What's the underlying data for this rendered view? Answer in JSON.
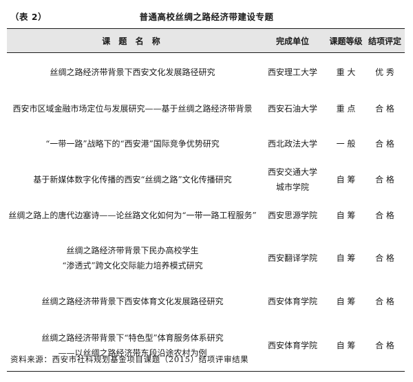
{
  "header": {
    "table_number": "（表 2）",
    "title": "普通高校丝绸之路经济带建设专题"
  },
  "columns": [
    "课 题 名 称",
    "完成单位",
    "课题等级",
    "结项评定"
  ],
  "rows": [
    {
      "name": [
        "丝绸之路经济带背景下西安文化发展路径研究"
      ],
      "unit": [
        "西安理工大学"
      ],
      "level": "重 大",
      "result": "优 秀"
    },
    {
      "name": [
        "西安市区域金融市场定位与发展研究——基于丝绸之路经济带背景"
      ],
      "unit": [
        "西安石油大学"
      ],
      "level": "重 点",
      "result": "合 格"
    },
    {
      "name": [
        "“一带一路”战略下的“西安港”国际竞争优势研究"
      ],
      "unit": [
        "西北政法大学"
      ],
      "level": "一 般",
      "result": "合 格"
    },
    {
      "name": [
        "基于新媒体数字化传播的西安“丝绸之路”文化传播研究"
      ],
      "unit": [
        "西安交通大学",
        "城市学院"
      ],
      "level": "自 筹",
      "result": "合 格"
    },
    {
      "name": [
        "丝绸之路上的唐代边塞诗——论丝路文化如何为“一带一路工程服务”"
      ],
      "unit": [
        "西安思源学院"
      ],
      "level": "自 筹",
      "result": "合 格"
    },
    {
      "name": [
        "丝绸之路经济带背景下民办高校学生",
        "“渗透式”跨文化交际能力培养模式研究"
      ],
      "unit": [
        "西安翻译学院"
      ],
      "level": "自 筹",
      "result": "合 格"
    },
    {
      "name": [
        "丝绸之路经济带背景下西安体育文化发展路径研究"
      ],
      "unit": [
        "西安体育学院"
      ],
      "level": "自 筹",
      "result": "合 格"
    },
    {
      "name": [
        "丝绸之路经济带背景下“特色型”体育服务体系研究",
        "——以丝绸之路经济带东段沿途农村为例"
      ],
      "unit": [
        "西安体育学院"
      ],
      "level": "自 筹",
      "result": "合 格"
    }
  ],
  "footer": "资料来源：西安市社科规划基金项目课题（2015）结项评审结果"
}
